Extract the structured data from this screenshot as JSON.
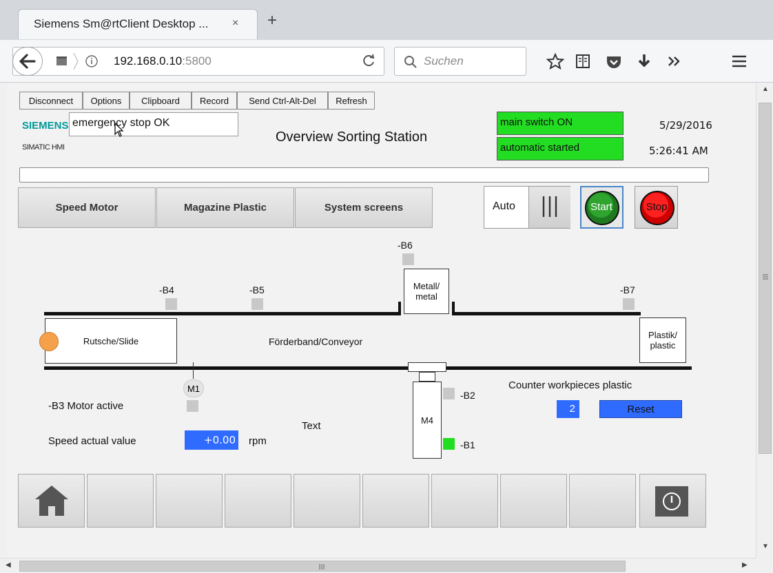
{
  "browser": {
    "tab_title": "Siemens Sm@rtClient Desktop ...",
    "tab_close": "×",
    "new_tab": "+",
    "url_host": "192.168.0.10",
    "url_port": ":5800",
    "search_placeholder": "Suchen"
  },
  "vnc_toolbar": [
    "Disconnect",
    "Options",
    "Clipboard",
    "Record",
    "Send Ctrl-Alt-Del",
    "Refresh"
  ],
  "hmi": {
    "brand": "SIEMENS",
    "brand_sub": "SIMATIC HMI",
    "alarm_text": "emergency stop OK",
    "title": "Overview Sorting Station",
    "status_main_switch": "main switch ON",
    "status_automatic": "automatic started",
    "date": "5/29/2016",
    "time": "5:26:41 AM",
    "colors": {
      "green": "#22dd22",
      "blue": "#2f6bff",
      "red": "#ee1111",
      "orange": "#f5a04a"
    },
    "nav": [
      "Speed Motor",
      "Magazine Plastic",
      "System screens"
    ],
    "mode_label": "Auto",
    "start_label": "Start",
    "stop_label": "Stop",
    "sensors": {
      "b6": "-B6",
      "b4": "-B4",
      "b5": "-B5",
      "b7": "-B7",
      "b2": "-B2",
      "b1": "-B1"
    },
    "metal_box": "Metall/\nmetal",
    "plastic_box": "Plastik/\nplastic",
    "slide_box": "Rutsche/Slide",
    "conveyor_label": "Förderband/Conveyor",
    "motor_m1": "M1",
    "motor_m4": "M4",
    "b3_label": "-B3 Motor active",
    "speed_label": "Speed actual value",
    "speed_value": "+0.00",
    "speed_unit": "rpm",
    "text_placeholder": "Text",
    "counter_label": "Counter workpieces plastic",
    "counter_value": "2",
    "reset_label": "Reset"
  }
}
